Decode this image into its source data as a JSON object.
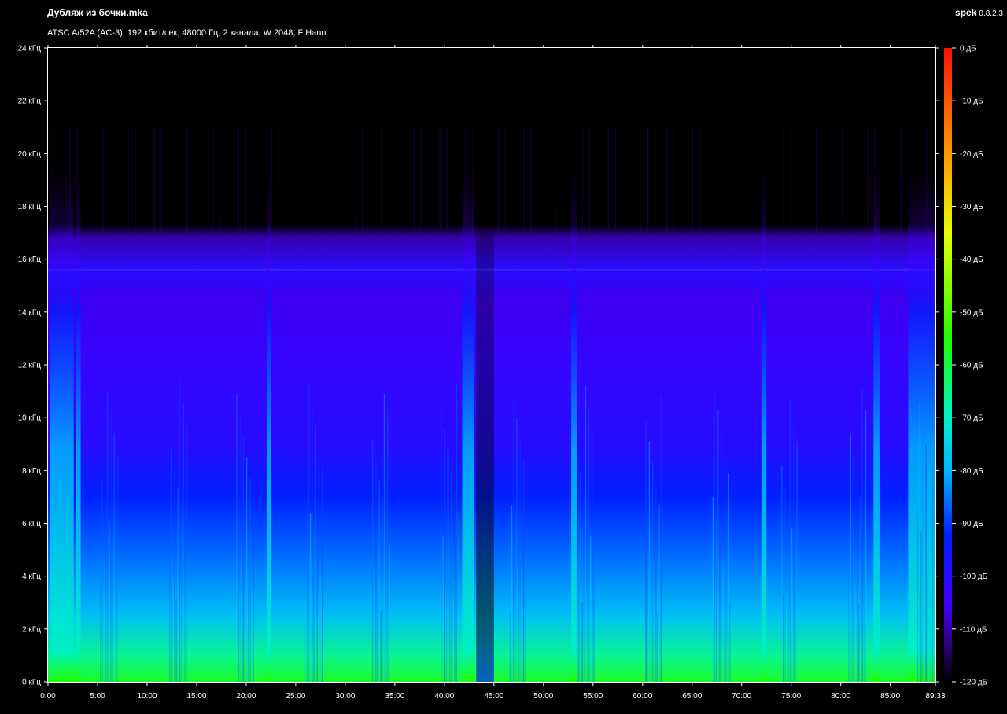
{
  "header": {
    "file_title": "Дубляж из бочки.mka",
    "app_name": "spek",
    "app_version": "0.8.2.3",
    "subtitle": "ATSC A/52A (AC-3), 192 кбит/сек, 48000 Гц, 2 канала, W:2048, F:Hann"
  },
  "chart_data": {
    "type": "heatmap",
    "title": "Дубляж из бочки.mka",
    "subtitle": "ATSC A/52A (AC-3), 192 кбит/сек, 48000 Гц, 2 канала, W:2048, F:Hann",
    "xlabel": "",
    "ylabel": "",
    "x_range_seconds": [
      0,
      5373
    ],
    "xlim_minutes": [
      0,
      89.55
    ],
    "ylim_khz": [
      0,
      24
    ],
    "x_ticks": [
      {
        "value": 0,
        "label": "0:00"
      },
      {
        "value": 5,
        "label": "5:00"
      },
      {
        "value": 10,
        "label": "10:00"
      },
      {
        "value": 15,
        "label": "15:00"
      },
      {
        "value": 20,
        "label": "20:00"
      },
      {
        "value": 25,
        "label": "25:00"
      },
      {
        "value": 30,
        "label": "30:00"
      },
      {
        "value": 35,
        "label": "35:00"
      },
      {
        "value": 40,
        "label": "40:00"
      },
      {
        "value": 45,
        "label": "45:00"
      },
      {
        "value": 50,
        "label": "50:00"
      },
      {
        "value": 55,
        "label": "55:00"
      },
      {
        "value": 60,
        "label": "60:00"
      },
      {
        "value": 65,
        "label": "65:00"
      },
      {
        "value": 70,
        "label": "70:00"
      },
      {
        "value": 75,
        "label": "75:00"
      },
      {
        "value": 80,
        "label": "80:00"
      },
      {
        "value": 85,
        "label": "85:00"
      },
      {
        "value": 89.55,
        "label": "89:33"
      }
    ],
    "y_ticks": [
      {
        "value": 0,
        "label": "0 кГц"
      },
      {
        "value": 2,
        "label": "2 кГц"
      },
      {
        "value": 4,
        "label": "4 кГц"
      },
      {
        "value": 6,
        "label": "6 кГц"
      },
      {
        "value": 8,
        "label": "8 кГц"
      },
      {
        "value": 10,
        "label": "10 кГц"
      },
      {
        "value": 12,
        "label": "12 кГц"
      },
      {
        "value": 14,
        "label": "14 кГц"
      },
      {
        "value": 16,
        "label": "16 кГц"
      },
      {
        "value": 18,
        "label": "18 кГц"
      },
      {
        "value": 20,
        "label": "20 кГц"
      },
      {
        "value": 22,
        "label": "22 кГц"
      },
      {
        "value": 24,
        "label": "24 кГц"
      }
    ],
    "colorbar": {
      "range_db": [
        -120,
        0
      ],
      "ticks": [
        {
          "value": 0,
          "label": "0 дБ"
        },
        {
          "value": -10,
          "label": "-10 дБ"
        },
        {
          "value": -20,
          "label": "-20 дБ"
        },
        {
          "value": -30,
          "label": "-30 дБ"
        },
        {
          "value": -40,
          "label": "-40 дБ"
        },
        {
          "value": -50,
          "label": "-50 дБ"
        },
        {
          "value": -60,
          "label": "-60 дБ"
        },
        {
          "value": -70,
          "label": "-70 дБ"
        },
        {
          "value": -80,
          "label": "-80 дБ"
        },
        {
          "value": -90,
          "label": "-90 дБ"
        },
        {
          "value": -100,
          "label": "-100 дБ"
        },
        {
          "value": -110,
          "label": "-110 дБ"
        },
        {
          "value": -120,
          "label": "-120 дБ"
        }
      ],
      "stops": [
        {
          "db": 0,
          "color": "#ff1000"
        },
        {
          "db": -20,
          "color": "#ff9a00"
        },
        {
          "db": -35,
          "color": "#e8ff00"
        },
        {
          "db": -55,
          "color": "#20ff00"
        },
        {
          "db": -70,
          "color": "#00f0c8"
        },
        {
          "db": -80,
          "color": "#00b4ff"
        },
        {
          "db": -92,
          "color": "#0020ff"
        },
        {
          "db": -105,
          "color": "#4000ff"
        },
        {
          "db": -113,
          "color": "#30007a"
        },
        {
          "db": -120,
          "color": "#000000"
        }
      ]
    },
    "spectral_profile": [
      {
        "khz": 0,
        "db": -58
      },
      {
        "khz": 1,
        "db": -66
      },
      {
        "khz": 2.5,
        "db": -78
      },
      {
        "khz": 4.5,
        "db": -85
      },
      {
        "khz": 7,
        "db": -92
      },
      {
        "khz": 9,
        "db": -100
      },
      {
        "khz": 12,
        "db": -103
      },
      {
        "khz": 14.5,
        "db": -106
      },
      {
        "khz": 15.6,
        "db": -100
      },
      {
        "khz": 16.8,
        "db": -110
      },
      {
        "khz": 17.3,
        "db": -120
      },
      {
        "khz": 24,
        "db": -120
      }
    ],
    "features": {
      "lowpass_cutoff_khz": 17,
      "tone_line_khz": 15.6,
      "sparse_content_max_khz": 21,
      "loud_segments_minutes": [
        [
          0.2,
          2.6
        ],
        [
          2.8,
          3.3
        ],
        [
          22.1,
          22.5
        ],
        [
          41.8,
          43.0
        ],
        [
          52.8,
          53.4
        ],
        [
          72.0,
          72.5
        ],
        [
          83.3,
          83.9
        ],
        [
          86.8,
          89.55
        ]
      ],
      "quiet_segments_minutes": [
        [
          43.2,
          45.0
        ]
      ]
    },
    "grid": false,
    "legend": "colorbar-right"
  },
  "colors": {
    "background": "#000000",
    "axis": "#ffffff",
    "text": "#ffffff"
  }
}
